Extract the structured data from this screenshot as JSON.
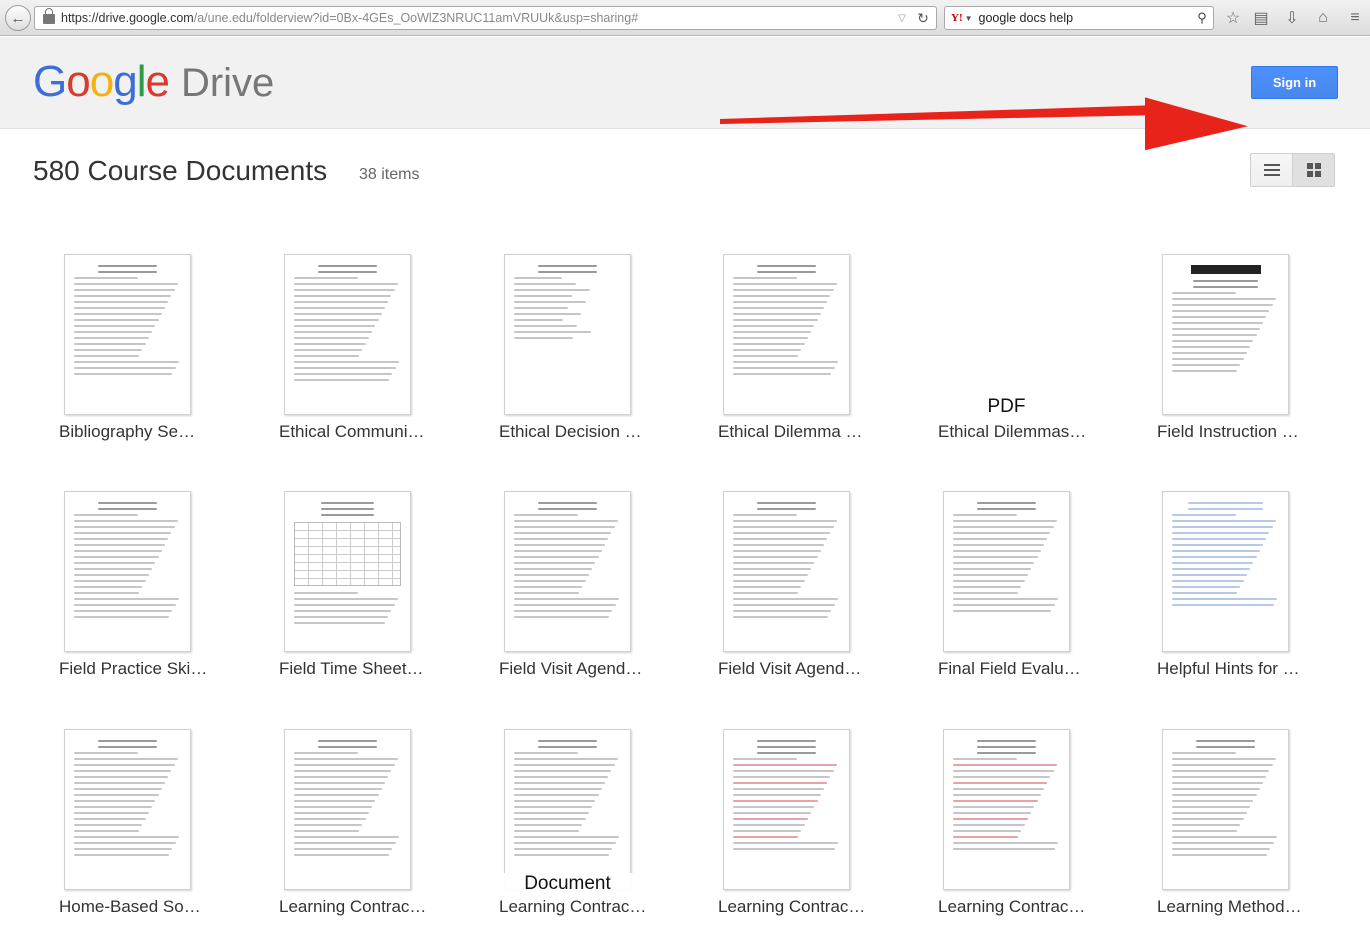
{
  "browser": {
    "url_prefix": "https://drive.google.com",
    "url_rest": "/a/une.edu/folderview?id=0Bx-4GEs_OoWlZ3NRUC11amVRUUk&usp=sharing#",
    "search_engine": "Y!",
    "search_query": "google docs help"
  },
  "header": {
    "logo_letters": [
      "G",
      "o",
      "o",
      "g",
      "l",
      "e"
    ],
    "product": "Drive",
    "sign_in_label": "Sign in",
    "arrow_color": "#e8231a"
  },
  "folder": {
    "title": "580 Course Documents",
    "count": "38 items"
  },
  "files": [
    {
      "name": "Bibliography Se…",
      "overlay": ""
    },
    {
      "name": "Ethical Communi…",
      "overlay": ""
    },
    {
      "name": "Ethical Decision …",
      "overlay": ""
    },
    {
      "name": "Ethical Dilemma …",
      "overlay": ""
    },
    {
      "name": "Ethical Dilemmas…",
      "overlay": "PDF"
    },
    {
      "name": "Field Instruction …",
      "overlay": ""
    },
    {
      "name": "Field Practice Ski…",
      "overlay": ""
    },
    {
      "name": "Field Time Sheet…",
      "overlay": ""
    },
    {
      "name": "Field Visit Agend…",
      "overlay": ""
    },
    {
      "name": "Field Visit Agend…",
      "overlay": ""
    },
    {
      "name": "Final Field Evalu…",
      "overlay": ""
    },
    {
      "name": "Helpful Hints for …",
      "overlay": ""
    },
    {
      "name": "Home-Based So…",
      "overlay": ""
    },
    {
      "name": "Learning Contrac…",
      "overlay": ""
    },
    {
      "name": "Learning Contrac…",
      "overlay": "Document"
    },
    {
      "name": "Learning Contrac…",
      "overlay": ""
    },
    {
      "name": "Learning Contrac…",
      "overlay": ""
    },
    {
      "name": "Learning Method…",
      "overlay": ""
    }
  ]
}
